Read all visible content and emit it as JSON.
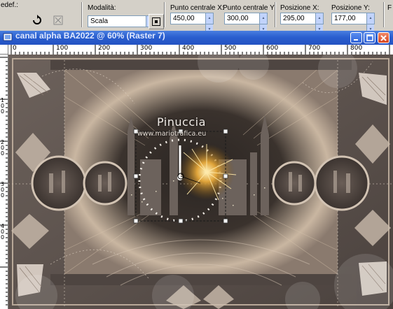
{
  "toolbar": {
    "preset_label": "edef.:",
    "mode": {
      "label": "Modalità:",
      "value": "Scala"
    },
    "center_x": {
      "label": "Punto centrale X:",
      "value": "450,00"
    },
    "center_y": {
      "label": "Punto centrale Y:",
      "value": "300,00"
    },
    "pos_x": {
      "label": "Posizione X:",
      "value": "295,00"
    },
    "pos_y": {
      "label": "Posizione Y:",
      "value": "177,00"
    },
    "edge_label": "F"
  },
  "document": {
    "title": "canal alpha BA2022 @ 60% (Raster 7)"
  },
  "rulers": {
    "top_ticks": [
      "0",
      "100",
      "200",
      "300",
      "400",
      "500",
      "600",
      "700",
      "800"
    ],
    "left_ticks": [
      "1 0 0",
      "2 0 0",
      "3 0 0",
      "4 0 0"
    ]
  },
  "canvas": {
    "watermark": "Pinuccia",
    "watermark_url": "www.mariotrafica.eu"
  },
  "icons": [
    "reset-icon",
    "deform-icon",
    "center-icon",
    "minimize-icon",
    "restore-icon",
    "close-icon"
  ]
}
